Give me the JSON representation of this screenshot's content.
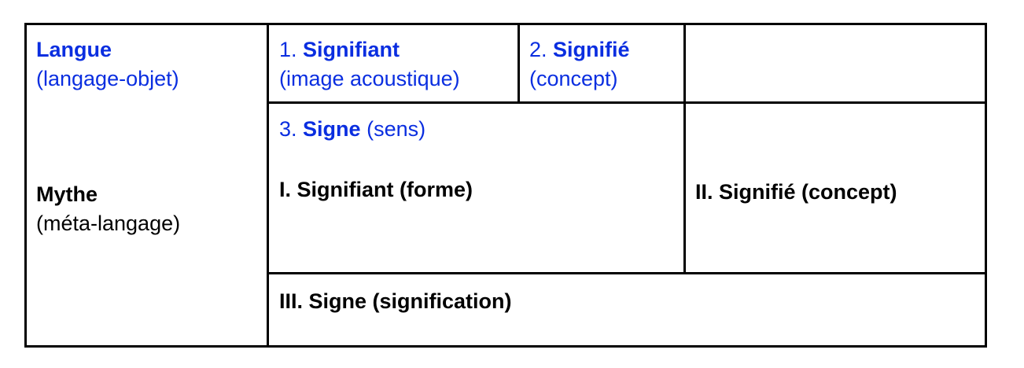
{
  "colors": {
    "language_level": "#0a2ee0",
    "myth_level": "#000000",
    "border": "#000000"
  },
  "langue": {
    "title": "Langue",
    "subtitle": "(langage-objet)",
    "signifiant": {
      "number": "1.",
      "label": "Signifiant",
      "detail": "(image acoustique)"
    },
    "signifie": {
      "number": "2.",
      "label": "Signifié",
      "detail": "(concept)"
    },
    "signe": {
      "number": "3.",
      "label": "Signe",
      "detail": "(sens)"
    }
  },
  "mythe": {
    "title": "Mythe",
    "subtitle": "(méta-langage)",
    "signifiant": "I. Signifiant (forme)",
    "signifie": "II. Signifié (concept)",
    "signe": "III. Signe (signification)"
  }
}
